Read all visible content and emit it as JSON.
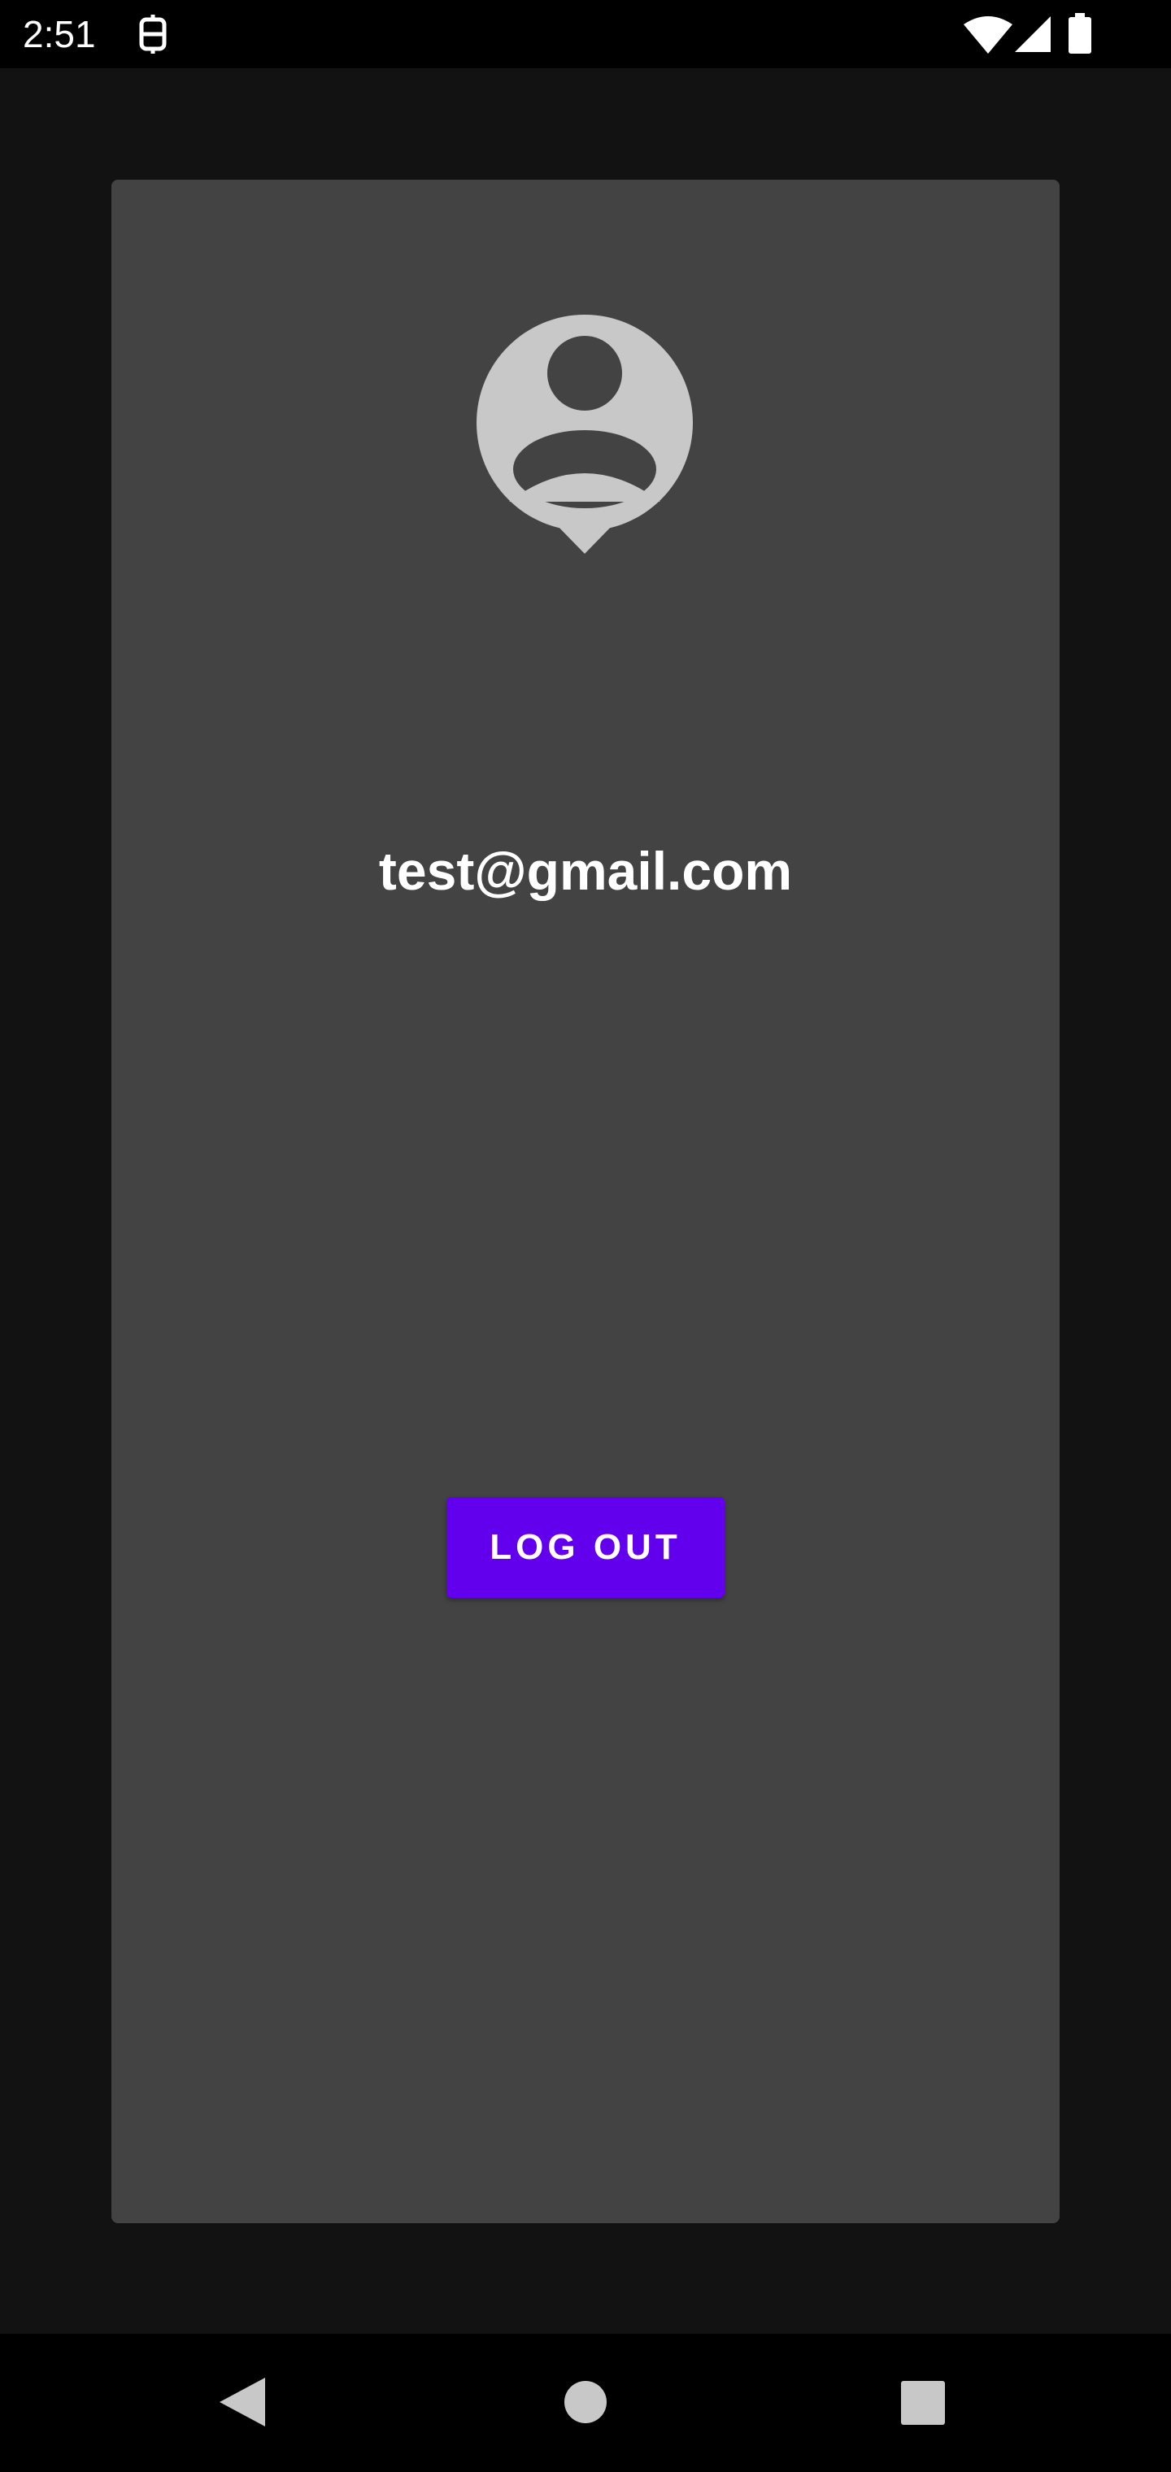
{
  "status_bar": {
    "time": "2:51",
    "icons": [
      "sync-icon",
      "wifi-icon",
      "cellular-signal-icon",
      "battery-icon"
    ]
  },
  "profile": {
    "avatar_icon": "account-avatar-icon",
    "email": "test@gmail.com",
    "logout_label": "LOG OUT"
  },
  "nav_bar": {
    "icons": [
      "back-icon",
      "home-icon",
      "recents-icon"
    ]
  },
  "colors": {
    "background": "#121212",
    "card": "#434343",
    "accent": "#6200ee",
    "avatar": "#c8c8c8",
    "text": "#ffffff"
  }
}
